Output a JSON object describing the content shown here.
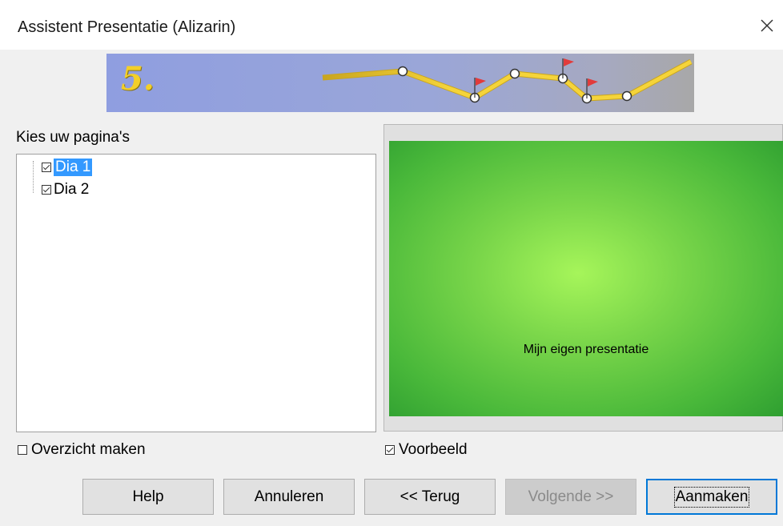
{
  "window": {
    "title": "Assistent Presentatie (Alizarin)"
  },
  "banner": {
    "step_label": "5."
  },
  "pages": {
    "label": "Kies uw pagina's",
    "items": [
      {
        "label": "Dia 1",
        "checked": true,
        "selected": true
      },
      {
        "label": "Dia 2",
        "checked": true,
        "selected": false
      }
    ]
  },
  "preview": {
    "slide_text": "Mijn eigen presentatie"
  },
  "options": {
    "summary_label": "Overzicht maken",
    "summary_checked": false,
    "preview_label": "Voorbeeld",
    "preview_checked": true
  },
  "buttons": {
    "help": "Help",
    "cancel": "Annuleren",
    "back": "<< Terug",
    "next": "Volgende >>",
    "create": "Aanmaken"
  },
  "colors": {
    "selection": "#3399ff",
    "default_button_border": "#0078d7",
    "slide_green": "#7ad64a"
  }
}
